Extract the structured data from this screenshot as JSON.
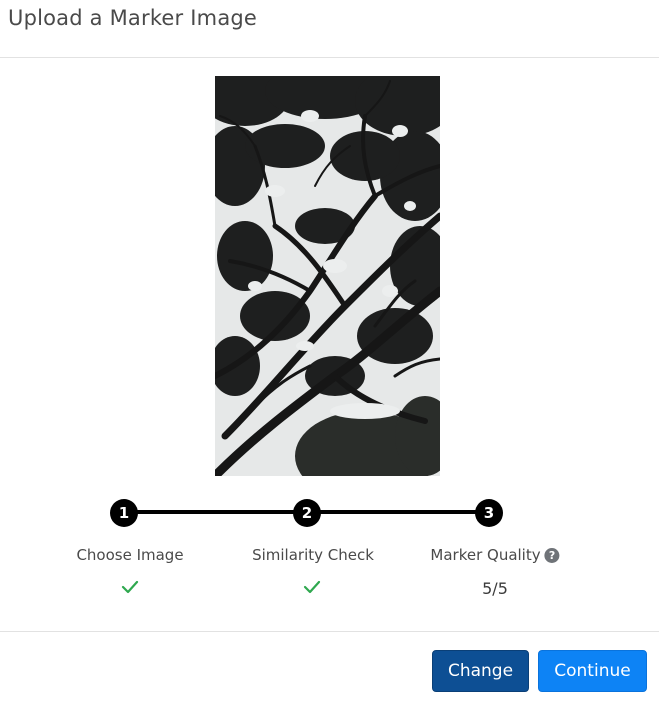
{
  "modal": {
    "title": "Upload a Marker Image"
  },
  "preview": {
    "alt": "uploaded marker image: tree canopy against sky"
  },
  "steps": [
    {
      "number": "1",
      "label": "Choose Image",
      "status": "complete",
      "icon": "check-icon"
    },
    {
      "number": "2",
      "label": "Similarity Check",
      "status": "complete",
      "icon": "check-icon"
    },
    {
      "number": "3",
      "label": "Marker Quality",
      "status": "complete",
      "value": "5/5",
      "help_icon": "question-circle-icon",
      "help_glyph": "?"
    }
  ],
  "buttons": {
    "change": "Change",
    "continue": "Continue"
  },
  "colors": {
    "step_dot": "#000000",
    "check": "#2fa84f",
    "change_button": "#0d4f94",
    "continue_button": "#0d83f5"
  }
}
